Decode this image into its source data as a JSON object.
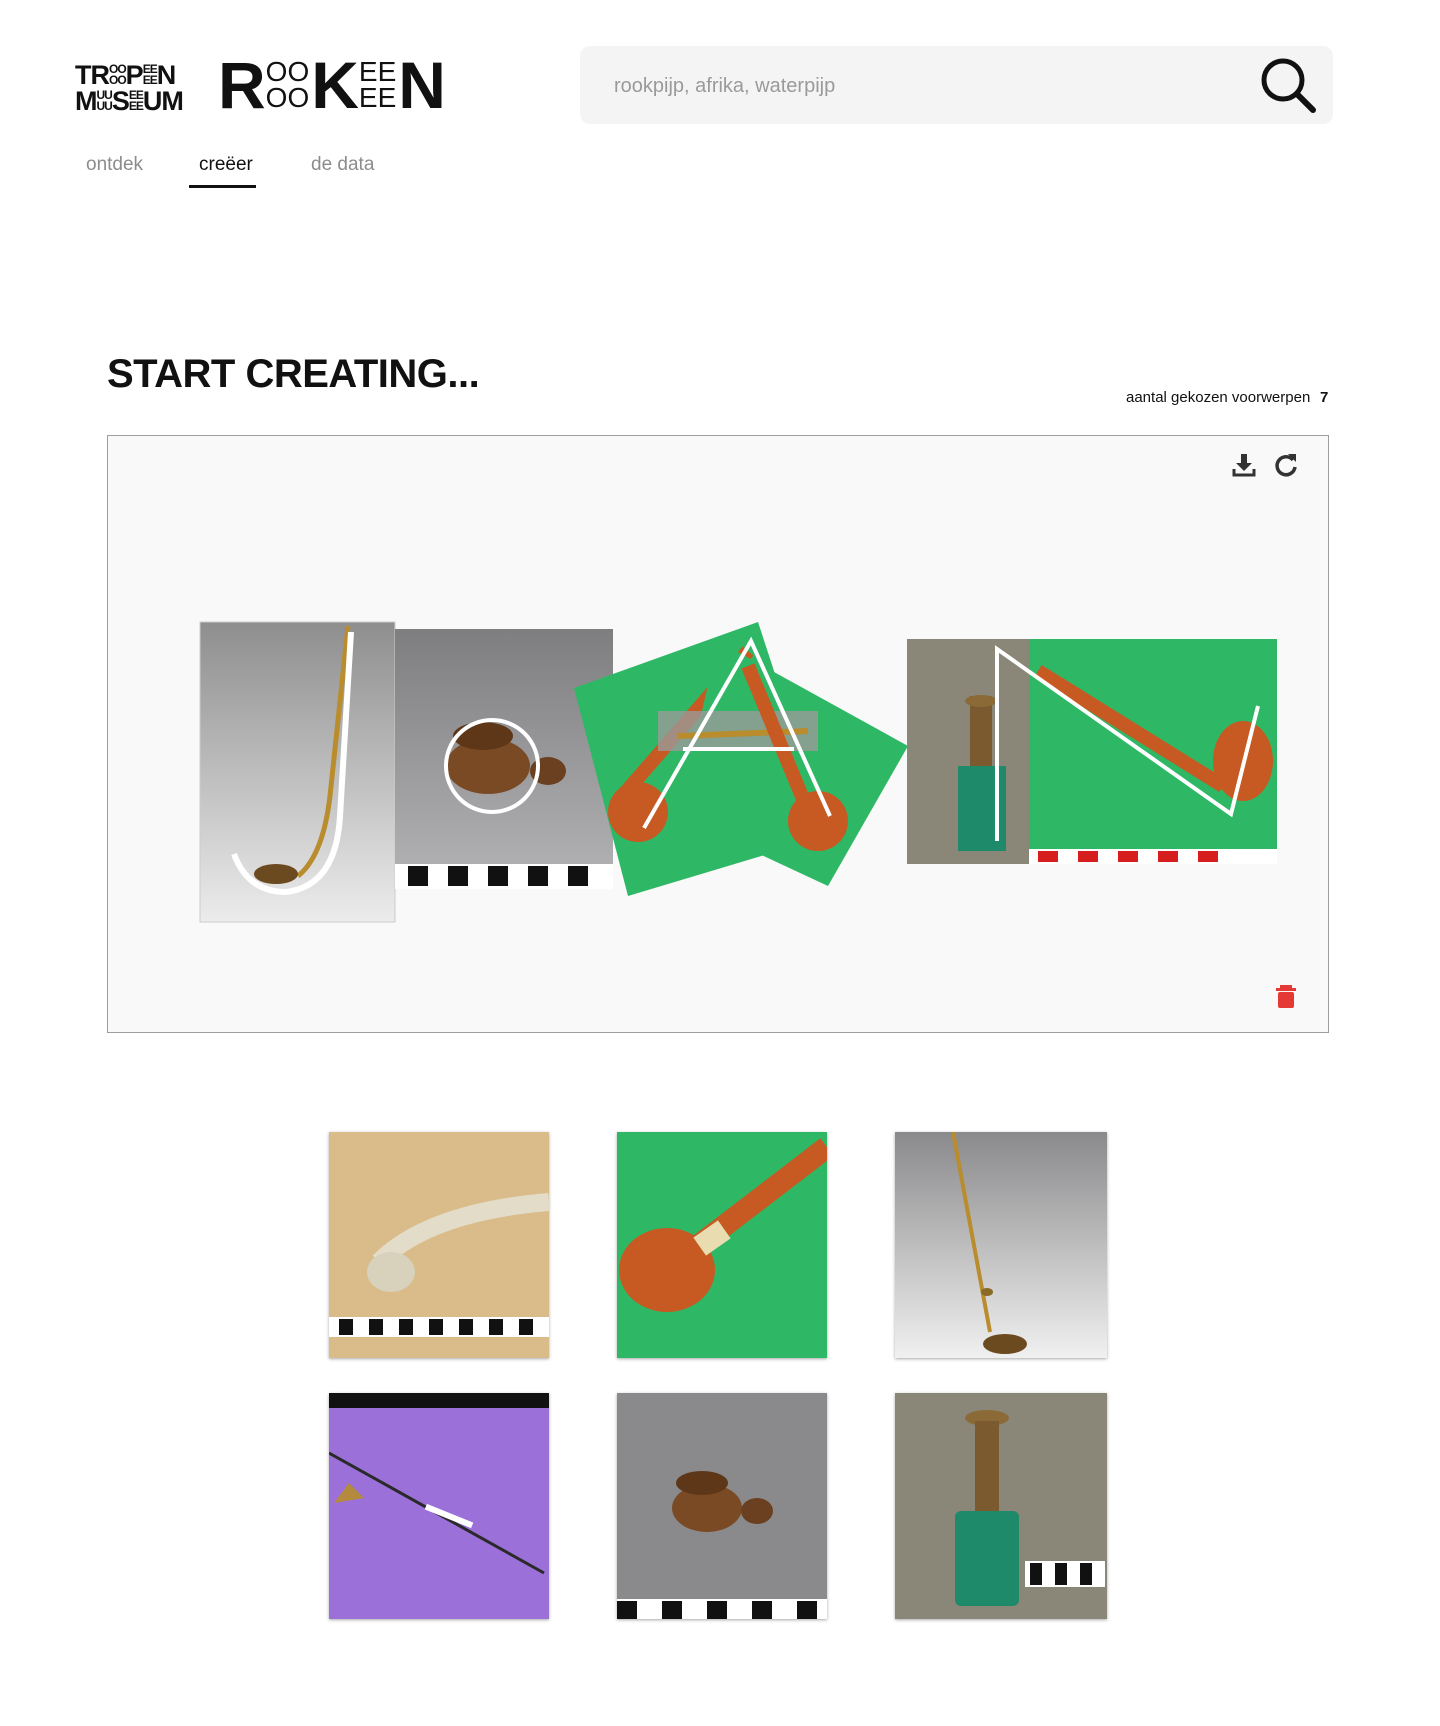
{
  "header": {
    "search": {
      "placeholder": "rookpijp, afrika, waterpijp",
      "value": ""
    },
    "search_icon": "search-icon"
  },
  "logos": {
    "tropen": {
      "row1_big": "TR",
      "row1_top": "OO",
      "row1_bottom": "OO",
      "row1_mid": "P",
      "row1_stack2_top": "EE",
      "row1_stack2_bottom": "EE",
      "row1_end": "N",
      "row2_big": "M",
      "row2_top": "UU",
      "row2_bottom": "UU",
      "row2_mid": "S",
      "row2_stack2_top": "EE",
      "row2_stack2_bottom": "EE",
      "row2_end": "UM"
    },
    "rooken": {
      "start": "R",
      "o_top": "OO",
      "o_bottom": "OO",
      "k": "K",
      "e_top": "EE",
      "e_bottom": "EE",
      "end": "N"
    }
  },
  "nav": {
    "tabs": [
      {
        "label": "ontdek",
        "active": false
      },
      {
        "label": "creëer",
        "active": true
      },
      {
        "label": "de data",
        "active": false
      }
    ]
  },
  "main": {
    "title": "START CREATING...",
    "count_label": "aantal gekozen voorwerpen",
    "count_value": "7"
  },
  "canvas": {
    "toolbar": [
      "download-icon",
      "refresh-icon"
    ],
    "delete_icon": "trash-icon",
    "delete_color": "#e53935"
  },
  "gallery": {
    "items": [
      {
        "name": "ivory-pipe"
      },
      {
        "name": "orange-bowl-pipe"
      },
      {
        "name": "brass-long-pipe"
      },
      {
        "name": "long-pipe-on-purple"
      },
      {
        "name": "carved-wooden-bowl"
      },
      {
        "name": "beaded-water-pipe"
      }
    ]
  },
  "colors": {
    "accent_green": "#2eb866",
    "pipe_orange": "#c65a22",
    "trash_red": "#e53935"
  }
}
